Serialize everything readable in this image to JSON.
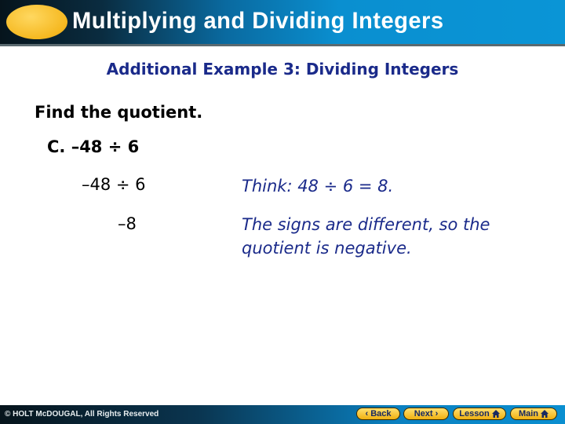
{
  "header": {
    "title": "Multiplying and Dividing Integers"
  },
  "slide": {
    "subtitle": "Additional Example 3: Dividing Integers",
    "instruction": "Find the quotient.",
    "part": "C. –48 ÷ 6",
    "steps": [
      {
        "math": "–48 ÷ 6",
        "note": "Think: 48 ÷ 6 = 8."
      },
      {
        "math": "–8",
        "note": "The signs are different, so the quotient is negative."
      }
    ]
  },
  "footer": {
    "copyright": "© HOLT McDOUGAL, All Rights Reserved",
    "buttons": {
      "back": "‹ Back",
      "next": "Next ›",
      "lesson": "Lesson",
      "main": "Main"
    }
  },
  "colors": {
    "accent": "#1a2a8a",
    "header_blue": "#0a95d6",
    "button_yellow": "#f0b010"
  },
  "icons": {
    "lesson": "home-icon",
    "main": "home-icon"
  }
}
